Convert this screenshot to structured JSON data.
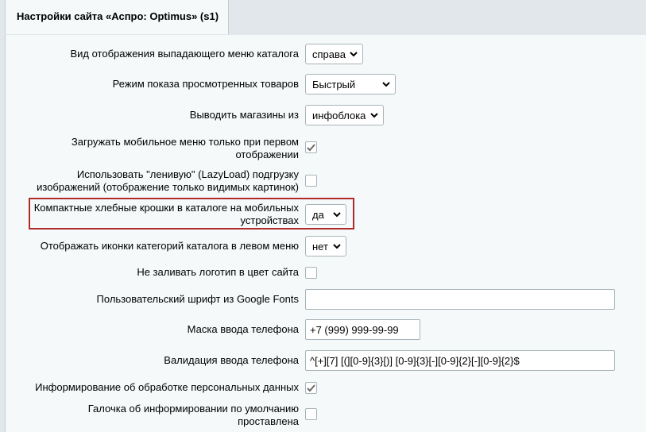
{
  "tab": {
    "title": "Настройки сайта «Аспро: Optimus» (s1)"
  },
  "settings": [
    {
      "label": "Вид отображения выпадающего меню каталога",
      "value": "справа"
    },
    {
      "label": "Режим показа просмотренных товаров",
      "value": "Быстрый"
    },
    {
      "label": "Выводить магазины из",
      "value": "инфоблока"
    },
    {
      "label_line1": "Загружать мобильное меню только при первом",
      "label_line2": "отображении",
      "checked": true
    },
    {
      "label_line1": "Использовать \"ленивую\" (LazyLoad) подгрузку",
      "label_line2": "изображений (отображение только видимых картинок)",
      "checked": false
    },
    {
      "label_line1": "Компактные хлебные крошки в каталоге на мобильных",
      "label_line2": "устройствах",
      "value": "да"
    },
    {
      "label": "Отображать иконки категорий каталога в левом меню",
      "value": "нет"
    },
    {
      "label": "Не заливать логотип в цвет сайта",
      "checked": false
    },
    {
      "label": "Пользовательский шрифт из Google Fonts",
      "value": ""
    },
    {
      "label": "Маска ввода телефона",
      "value": "+7 (999) 999-99-99"
    },
    {
      "label": "Валидация ввода телефона",
      "value": "^[+][7] [(][0-9]{3}[)] [0-9]{3}[-][0-9]{2}[-][0-9]{2}$"
    },
    {
      "label": "Информирование об обработке персональных данных",
      "checked": true
    },
    {
      "label_line1": "Галочка об информировании по умолчанию",
      "label_line2": "проставлена",
      "checked": false
    }
  ],
  "colors": {
    "highlight": "#b02a2a",
    "background": "#f5f9f9",
    "tabbar": "#e1e7ea"
  },
  "icons": {
    "check": "check-icon",
    "dropdown": "chevron-down-icon"
  }
}
